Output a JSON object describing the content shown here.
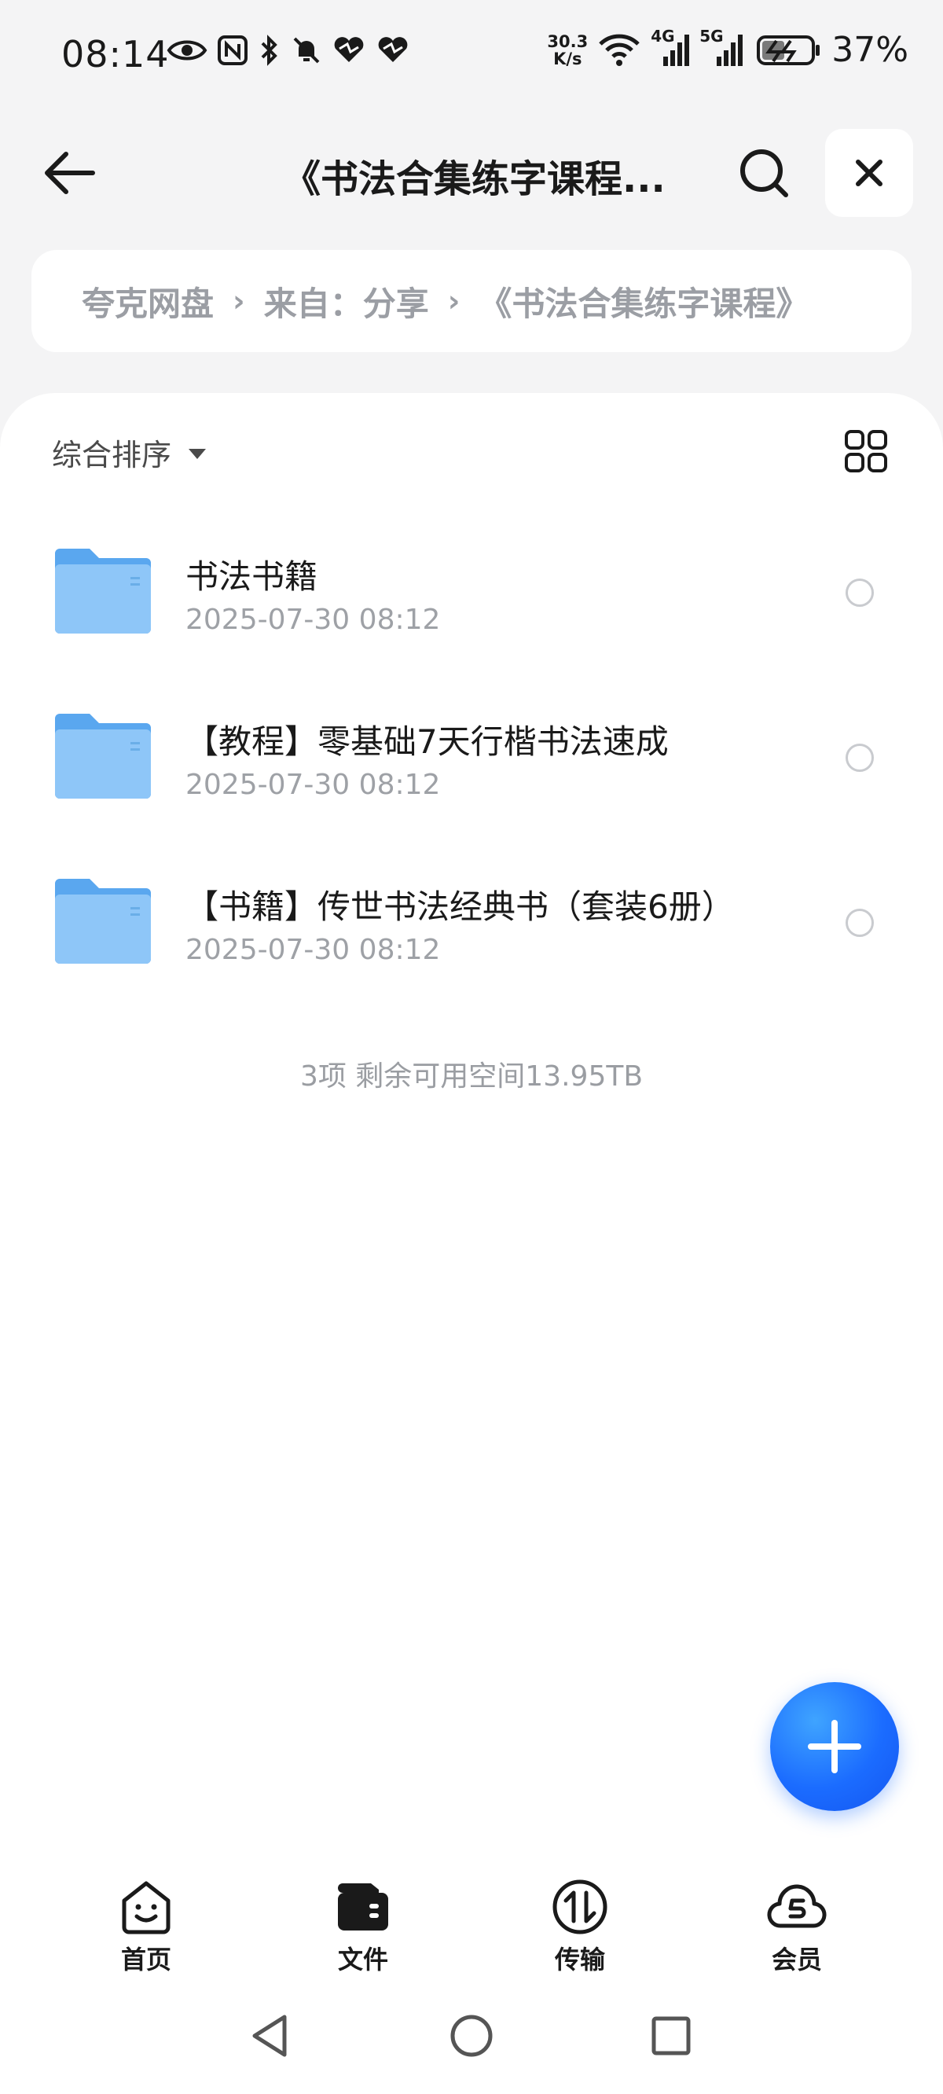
{
  "status_bar": {
    "time": "08:14",
    "net_speed_value": "30.3",
    "net_speed_unit": "K/s",
    "signal_4g_label": "4G",
    "signal_5g_label": "5G",
    "battery_percent": "37%"
  },
  "header": {
    "title": "《书法合集练字课程..."
  },
  "breadcrumb": {
    "items": [
      "夸克网盘",
      "来自：分享",
      "《书法合集练字课程》"
    ]
  },
  "toolbar": {
    "sort_label": "综合排序"
  },
  "files": [
    {
      "name": "书法书籍",
      "date": "2025-07-30 08:12"
    },
    {
      "name": "【教程】零基础7天行楷书法速成",
      "date": "2025-07-30 08:12"
    },
    {
      "name": "【书籍】传世书法经典书（套装6册）",
      "date": "2025-07-30 08:12"
    }
  ],
  "summary": "3项 剩余可用空间13.95TB",
  "bottom_nav": {
    "items": [
      {
        "label": "首页",
        "icon": "home-smile-icon"
      },
      {
        "label": "文件",
        "icon": "wallet-folder-icon"
      },
      {
        "label": "传输",
        "icon": "transfer-icon"
      },
      {
        "label": "会员",
        "icon": "cloud-vip-icon"
      }
    ]
  },
  "colors": {
    "accent_blue": "#1b6cff",
    "folder_blue": "#6db6f5",
    "background": "#f4f4f5"
  }
}
